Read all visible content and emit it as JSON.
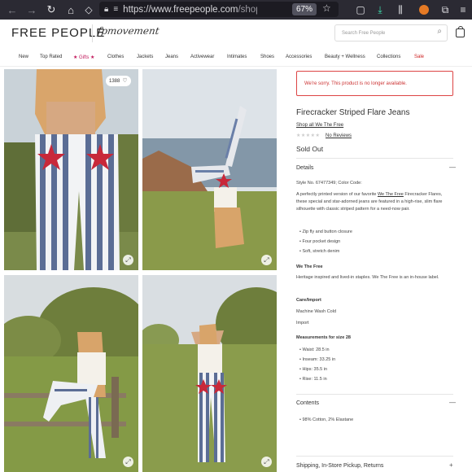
{
  "browser": {
    "url_main": "https://www.freepeople.com",
    "url_dim": "/shop/f",
    "zoom": "67%"
  },
  "header": {
    "logo": "FREE PEOPLE",
    "sub_logo": "fpmovement",
    "search_placeholder": "Search Free People"
  },
  "nav": {
    "items": [
      "New",
      "Top Rated",
      "★ Gifts ★",
      "Clothes",
      "Jackets",
      "Jeans",
      "Activewear",
      "Intimates",
      "Shoes",
      "Accessories",
      "Beauty + Wellness",
      "Collections",
      "Sale"
    ]
  },
  "gallery": {
    "likes": "1388"
  },
  "product": {
    "alert": "We're sorry. This product is no longer available.",
    "title": "Firecracker Striped Flare Jeans",
    "shop_all": "Shop all We The Free",
    "stars": "★★★★★",
    "reviews": "No Reviews",
    "status": "Sold Out",
    "details_heading": "Details",
    "style_line": "Style No. 67477349; Color Code:",
    "desc_pre": "A perfectly printed version of our favorite ",
    "desc_link": "We The Free",
    "desc_post": " Firecracker Flares, these special and star-adorned jeans are featured in a high-rise, slim flare silhouette with classic striped pattern for a need-now pair.",
    "features": [
      "Zip fly and button closure",
      "Four pocket design",
      "Soft, stretch denim"
    ],
    "brand_heading": "We The Free",
    "brand_text": "Heritage inspired and lived-in staples. We The Free is an in-house label.",
    "care_heading": "Care/Import",
    "care_wash": "Machine Wash Cold",
    "care_import": "Import",
    "measure_heading": "Measurements for size 28",
    "measures": [
      "Waist: 28.5 in",
      "Inseam: 33.25 in",
      "Hips: 35.5 in",
      "Rise: 11.5 in"
    ],
    "contents_heading": "Contents",
    "contents": [
      "98% Cotton, 2% Elastane"
    ],
    "shipping_heading": "Shipping, In-Store Pickup, Returns"
  }
}
